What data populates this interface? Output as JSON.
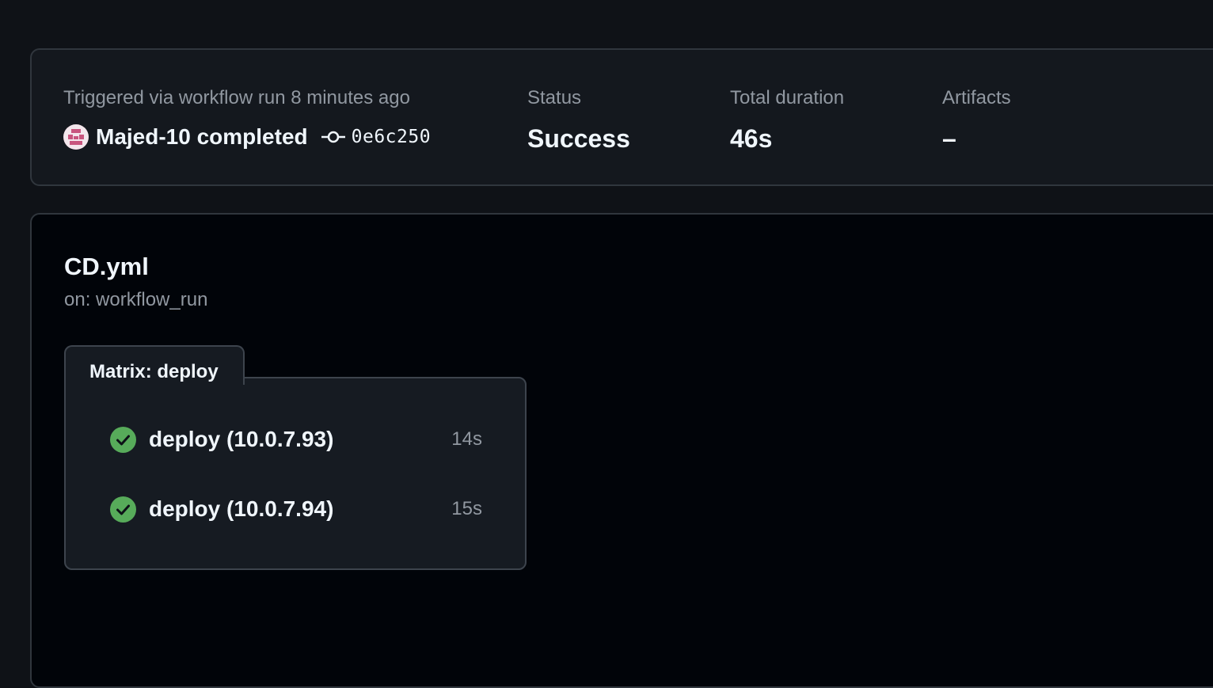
{
  "summary": {
    "trigger_text": "Triggered via workflow run 8 minutes ago",
    "actor": "Majed-10 completed",
    "commit_sha": "0e6c250",
    "status_label": "Status",
    "status_value": "Success",
    "duration_label": "Total duration",
    "duration_value": "46s",
    "artifacts_label": "Artifacts",
    "artifacts_value": "–"
  },
  "workflow": {
    "name": "CD.yml",
    "trigger": "on: workflow_run",
    "matrix_label": "Matrix: deploy",
    "jobs": [
      {
        "name": "deploy (10.0.7.93)",
        "duration": "14s",
        "status": "success"
      },
      {
        "name": "deploy (10.0.7.94)",
        "duration": "15s",
        "status": "success"
      }
    ]
  },
  "colors": {
    "page_background": "#0f1217",
    "success": "#57ab5a",
    "muted_text": "#9198a1",
    "border": "#30363d"
  },
  "icons": {
    "avatar": "identicon-avatar",
    "commit": "git-commit-icon",
    "job_status": "check-circle-icon"
  }
}
